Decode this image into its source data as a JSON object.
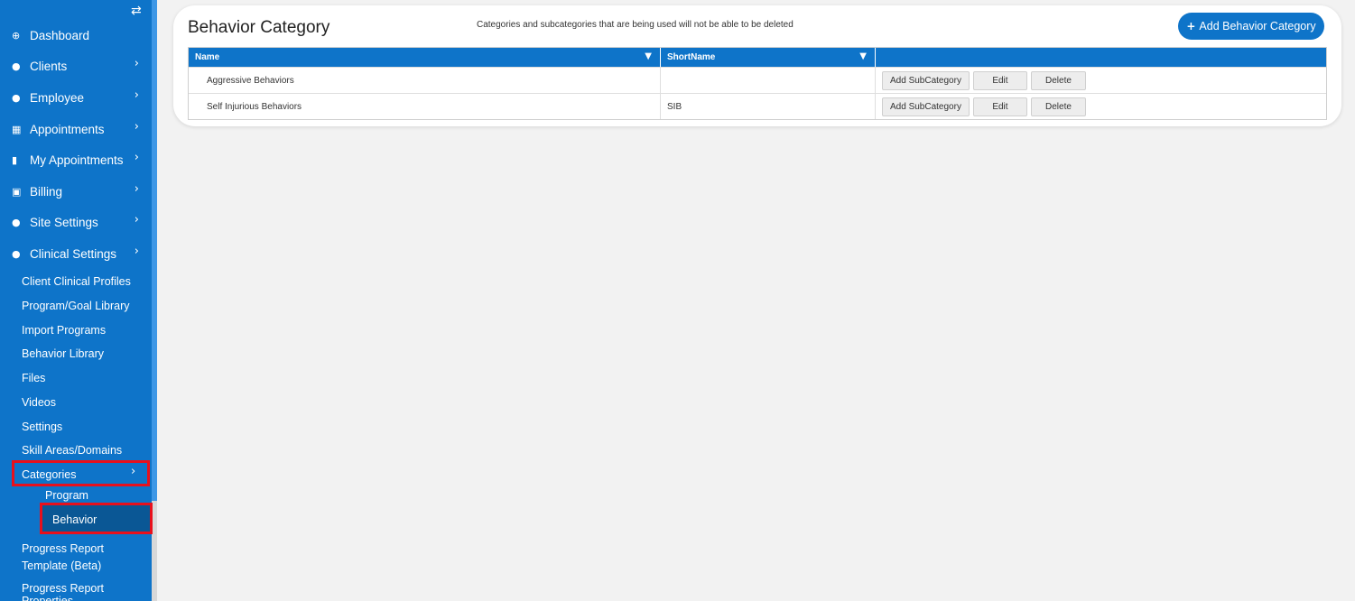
{
  "sidebar": {
    "toggle_icon": "⇄",
    "items": [
      {
        "label": "Dashboard",
        "icon": "dashboard-icon",
        "glyph": "⊕",
        "chevron": ""
      },
      {
        "label": "Clients",
        "icon": "user-icon",
        "glyph": "●",
        "chevron": "›"
      },
      {
        "label": "Employee",
        "icon": "users-icon",
        "glyph": "●",
        "chevron": "›"
      },
      {
        "label": "Appointments",
        "icon": "calendar-icon",
        "glyph": "▦",
        "chevron": "›"
      },
      {
        "label": "My Appointments",
        "icon": "building-icon",
        "glyph": "▮",
        "chevron": "›"
      },
      {
        "label": "Billing",
        "icon": "money-icon",
        "glyph": "▣",
        "chevron": "›"
      },
      {
        "label": "Site Settings",
        "icon": "user-icon",
        "glyph": "●",
        "chevron": "›"
      },
      {
        "label": "Clinical Settings",
        "icon": "user-icon",
        "glyph": "●",
        "chevron": "›"
      }
    ],
    "clinical_sub": [
      "Client Clinical Profiles",
      "Program/Goal Library",
      "Import Programs",
      "Behavior Library",
      "Files",
      "Videos",
      "Settings",
      "Skill Areas/Domains"
    ],
    "categories": {
      "label": "Categories",
      "chevron": "›"
    },
    "categories_sub": {
      "program": "Program",
      "behavior": "Behavior"
    },
    "progress_template": "Progress Report Template (Beta)",
    "progress_properties": "Progress Report Properties"
  },
  "page": {
    "title": "Behavior Category",
    "note": "Categories and subcategories that are being used will not be able to be deleted",
    "add_button": {
      "plus": "+",
      "label": "Add Behavior Category"
    }
  },
  "grid": {
    "columns": [
      {
        "label": "Name",
        "filter_icon": "▼"
      },
      {
        "label": "ShortName",
        "filter_icon": "▼"
      },
      {
        "label": ""
      }
    ],
    "rows": [
      {
        "name": "Aggressive Behaviors",
        "shortname": ""
      },
      {
        "name": "Self Injurious Behaviors",
        "shortname": "SIB"
      }
    ],
    "actions": {
      "add_sub": "Add SubCategory",
      "edit": "Edit",
      "delete": "Delete"
    }
  },
  "colors": {
    "sidebar": "#0e74c9",
    "highlight": "#e8101c",
    "active": "#0a5795"
  }
}
